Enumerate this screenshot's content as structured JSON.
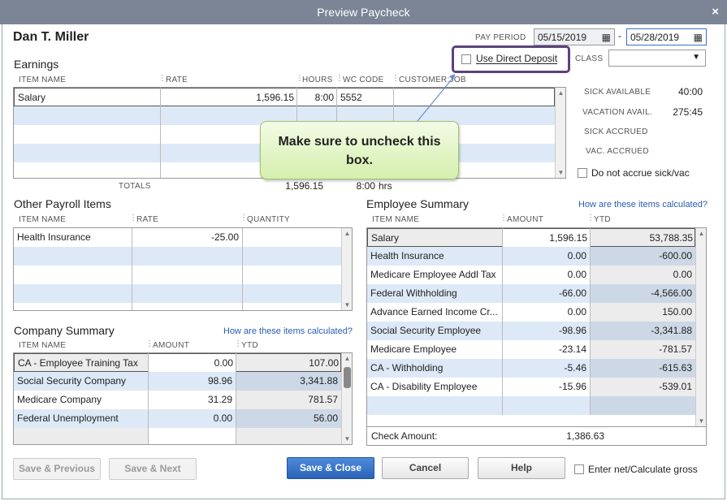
{
  "window": {
    "title": "Preview Paycheck",
    "close_glyph": "×"
  },
  "employee": {
    "name": "Dan T. Miller"
  },
  "pay_period": {
    "label": "PAY PERIOD",
    "start": "05/15/2019",
    "separator": "-",
    "end": "05/28/2019"
  },
  "direct_deposit": {
    "label": "Use Direct Deposit",
    "checked": false
  },
  "class_field": {
    "label": "CLASS",
    "value": ""
  },
  "earnings": {
    "title": "Earnings",
    "columns": [
      "ITEM NAME",
      "RATE",
      "HOURS",
      "WC CODE",
      "CUSTOMER:JOB"
    ],
    "rows": [
      {
        "item": "Salary",
        "rate": "1,596.15",
        "hours": "8:00",
        "wc_code": "5552",
        "customer_job": ""
      }
    ],
    "totals_label": "TOTALS",
    "total_rate": "1,596.15",
    "total_hours": "8:00",
    "hours_unit": "hrs"
  },
  "callout": {
    "line1": "Make sure to uncheck this",
    "line2": "box."
  },
  "side_balances": {
    "sick_available_label": "SICK AVAILABLE",
    "sick_available": "40:00",
    "vacation_avail_label": "VACATION AVAIL.",
    "vacation_avail": "275:45",
    "sick_accrued_label": "SICK ACCRUED",
    "vac_accrued_label": "VAC. ACCRUED",
    "do_not_accrue_label": "Do not accrue sick/vac"
  },
  "other_payroll": {
    "title": "Other Payroll Items",
    "columns": [
      "ITEM NAME",
      "RATE",
      "QUANTITY"
    ],
    "rows": [
      {
        "item": "Health Insurance",
        "rate": "-25.00",
        "quantity": ""
      }
    ]
  },
  "employee_summary": {
    "title": "Employee Summary",
    "link": "How are these items calculated?",
    "columns": [
      "ITEM NAME",
      "AMOUNT",
      "YTD"
    ],
    "rows": [
      {
        "item": "Salary",
        "amount": "1,596.15",
        "ytd": "53,788.35"
      },
      {
        "item": "Health Insurance",
        "amount": "0.00",
        "ytd": "-600.00"
      },
      {
        "item": "Medicare Employee Addl Tax",
        "amount": "0.00",
        "ytd": "0.00"
      },
      {
        "item": "Federal Withholding",
        "amount": "-66.00",
        "ytd": "-4,566.00"
      },
      {
        "item": "Advance Earned Income Cr...",
        "amount": "0.00",
        "ytd": "150.00"
      },
      {
        "item": "Social Security Employee",
        "amount": "-98.96",
        "ytd": "-3,341.88"
      },
      {
        "item": "Medicare Employee",
        "amount": "-23.14",
        "ytd": "-781.57"
      },
      {
        "item": "CA - Withholding",
        "amount": "-5.46",
        "ytd": "-615.63"
      },
      {
        "item": "CA - Disability Employee",
        "amount": "-15.96",
        "ytd": "-539.01"
      }
    ],
    "check_amount_label": "Check Amount:",
    "check_amount": "1,386.63"
  },
  "company_summary": {
    "title": "Company Summary",
    "link": "How are these items calculated?",
    "columns": [
      "ITEM NAME",
      "AMOUNT",
      "YTD"
    ],
    "rows": [
      {
        "item": "CA - Employee Training Tax",
        "amount": "0.00",
        "ytd": "107.00"
      },
      {
        "item": "Social Security Company",
        "amount": "98.96",
        "ytd": "3,341.88"
      },
      {
        "item": "Medicare Company",
        "amount": "31.29",
        "ytd": "781.57"
      },
      {
        "item": "Federal Unemployment",
        "amount": "0.00",
        "ytd": "56.00"
      }
    ]
  },
  "buttons": {
    "save_previous": "Save & Previous",
    "save_next": "Save & Next",
    "save_close": "Save & Close",
    "cancel": "Cancel",
    "help": "Help",
    "enter_net_label": "Enter net/Calculate gross"
  },
  "colors": {
    "accent": "#2a63b8",
    "highlight_border": "#5b4379",
    "callout_fill": "#d5efad",
    "row_alt": "#dde9f7"
  },
  "icons": {
    "calendar": "calendar-icon",
    "dropdown": "chevron-down-icon",
    "close": "close-icon"
  }
}
